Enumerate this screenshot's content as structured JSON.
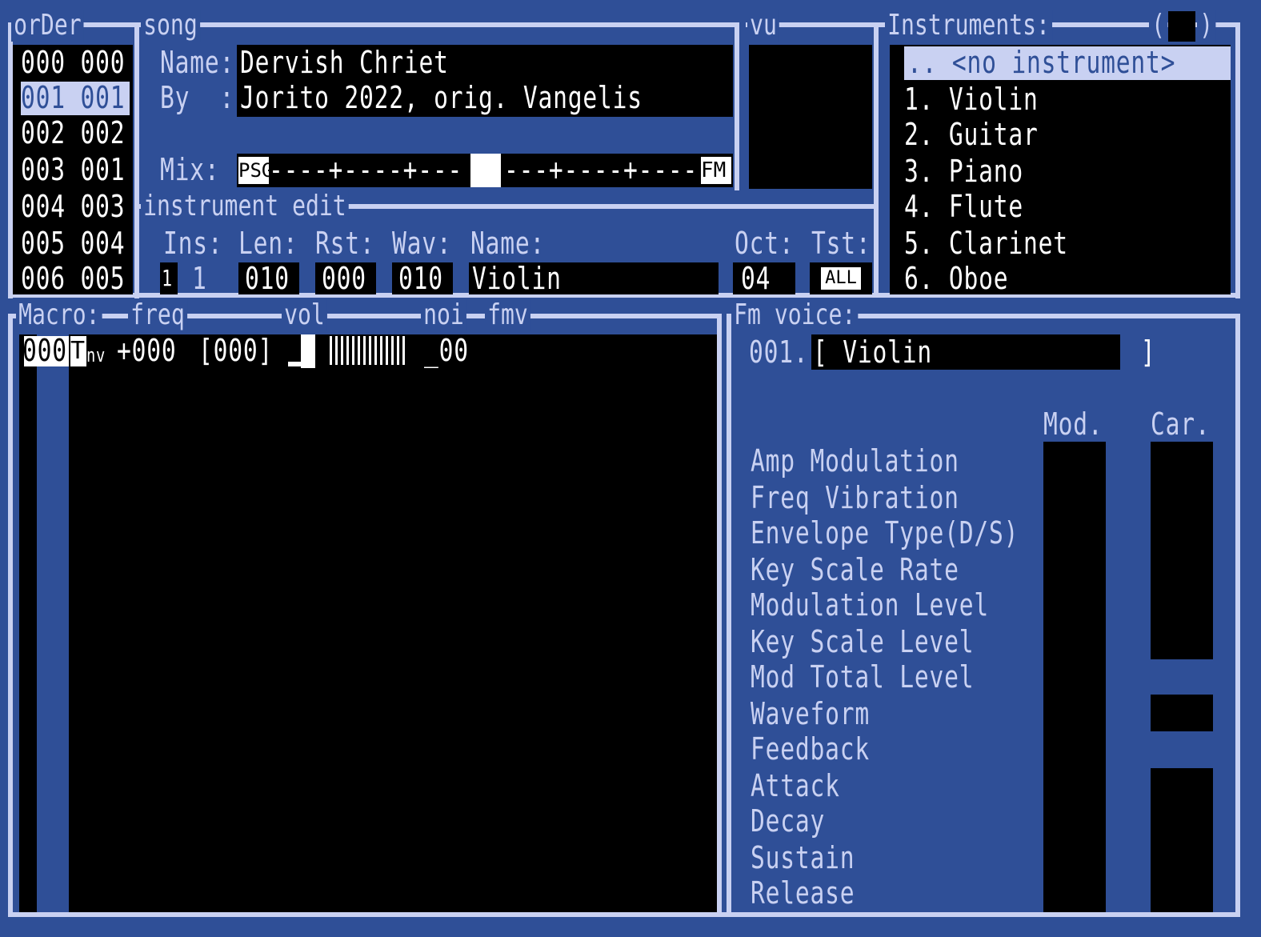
{
  "order": {
    "title": "orDer",
    "rows": [
      "000 000",
      "001 001",
      "002 002",
      "003 001",
      "004 003",
      "005 004",
      "006 005"
    ]
  },
  "song": {
    "title": "song",
    "name_label": "Name:",
    "name_value": "Dervish Chriet",
    "by_label": "By  :",
    "by_value": "Jorito 2022, orig. Vangelis",
    "mix_label": "Mix:",
    "mix_left": "PSG",
    "mix_track": "----+----+---",
    "mix_track_right": "---+----+----",
    "mix_right": "FM"
  },
  "vu": {
    "title": "vu"
  },
  "instruments": {
    "title": "Instruments:",
    "paren_open": "(",
    "paren_close": ")",
    "selected": ".. <no instrument>",
    "items": [
      "1. Violin",
      "2. Guitar",
      "3. Piano",
      "4. Flute",
      "5. Clarinet",
      "6. Oboe"
    ]
  },
  "instrument_edit": {
    "title": "instrument edit",
    "labels": [
      "Ins:",
      "Len:",
      "Rst:",
      "Wav:",
      "Name:",
      "Oct:",
      "Tst:"
    ],
    "ins_value": "1",
    "ins_num": "1",
    "len_value": "010",
    "rst_value": "000",
    "wav_value": "010",
    "name_value": "Violin",
    "oct_value": "04",
    "tst_value": "ALL"
  },
  "macro": {
    "title": "Macro:",
    "tabs": [
      "freq",
      "vol",
      "noi",
      "fmv"
    ],
    "row": {
      "idx": "000",
      "tone": "T",
      "mode": "nv",
      "freq": "+000",
      "vol": "[000]",
      "noi": "_00"
    }
  },
  "fm_voice": {
    "title": "Fm voice:",
    "voice_num": "001.",
    "voice_name": "[ Violin              ]",
    "col_mod": "Mod.",
    "col_car": "Car.",
    "params": [
      "Amp Modulation",
      "Freq Vibration",
      "Envelope Type(D/S)",
      "Key Scale Rate",
      "Modulation Level",
      "Key Scale Level",
      "Mod Total Level",
      "Waveform",
      "Feedback",
      "Attack",
      "Decay",
      "Sustain",
      "Release"
    ]
  },
  "colors": {
    "bg": "#2f4f97",
    "fg": "#c9d1f2",
    "panel": "#000000",
    "highlight": "#ffffff"
  }
}
